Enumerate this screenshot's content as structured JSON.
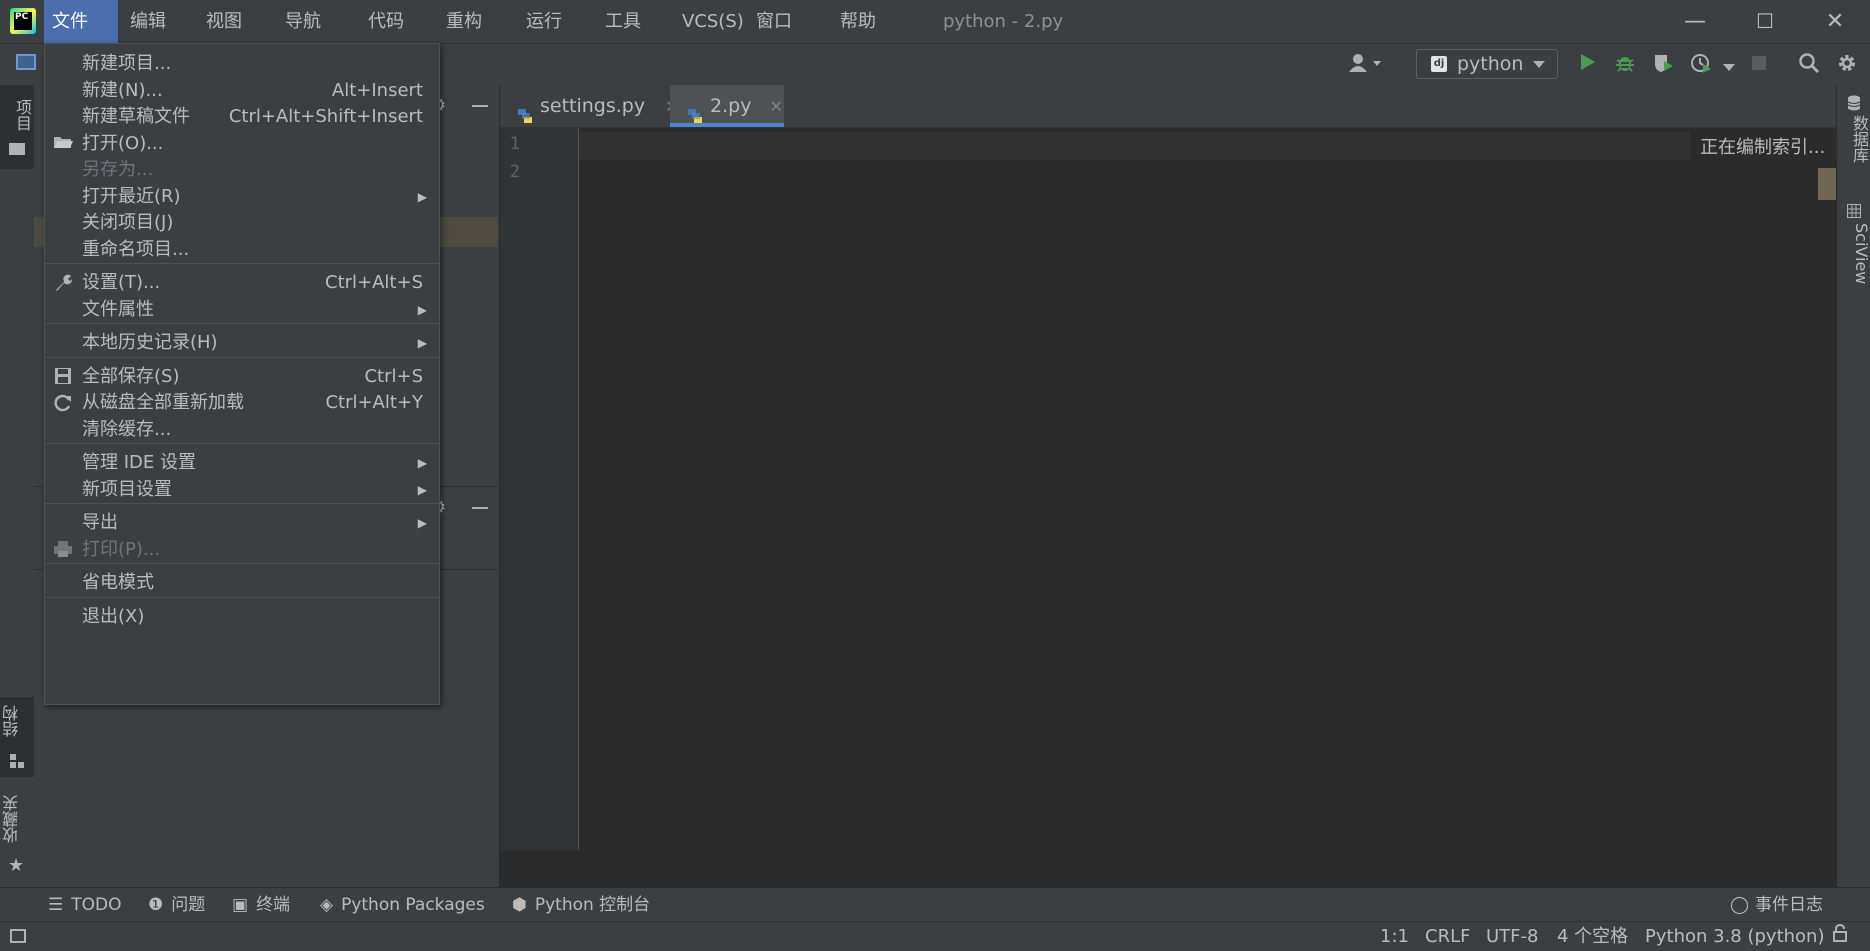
{
  "window": {
    "title": "python - 2.py",
    "minimize": "—",
    "maximize": "☐",
    "close": "✕"
  },
  "menubar": [
    "文件(F)",
    "编辑(E)",
    "视图(V)",
    "导航(N)",
    "代码(C)",
    "重构(R)",
    "运行(U)",
    "工具(T)",
    "VCS(S)",
    "窗口(W)",
    "帮助(H)"
  ],
  "toolbar": {
    "run_config": "python",
    "run_config_badge": "dj"
  },
  "left_tabs": {
    "project": "项目",
    "structure": "结构",
    "favorites": "收藏夹"
  },
  "right_tabs": {
    "database": "数据库",
    "sciview": "SciView"
  },
  "editor": {
    "tabs": [
      {
        "label": "settings.py",
        "active": false
      },
      {
        "label": "2.py",
        "active": true
      }
    ],
    "line_numbers": [
      "1",
      "2"
    ],
    "indexing_text": "正在编制索引..."
  },
  "file_menu": {
    "items": [
      {
        "label": "新建项目...",
        "shortcut": "",
        "icon": "",
        "submenu": false,
        "disabled": false
      },
      {
        "label": "新建(N)...",
        "shortcut": "Alt+Insert",
        "icon": "",
        "submenu": false,
        "disabled": false
      },
      {
        "label": "新建草稿文件",
        "shortcut": "Ctrl+Alt+Shift+Insert",
        "icon": "",
        "submenu": false,
        "disabled": false
      },
      {
        "label": "打开(O)...",
        "shortcut": "",
        "icon": "folder-icon",
        "submenu": false,
        "disabled": false
      },
      {
        "label": "另存为...",
        "shortcut": "",
        "icon": "",
        "submenu": false,
        "disabled": true
      },
      {
        "label": "打开最近(R)",
        "shortcut": "",
        "icon": "",
        "submenu": true,
        "disabled": false
      },
      {
        "label": "关闭项目(J)",
        "shortcut": "",
        "icon": "",
        "submenu": false,
        "disabled": false
      },
      {
        "label": "重命名项目...",
        "shortcut": "",
        "icon": "",
        "submenu": false,
        "disabled": false
      },
      {
        "sep": true
      },
      {
        "label": "设置(T)...",
        "shortcut": "Ctrl+Alt+S",
        "icon": "wrench-icon",
        "submenu": false,
        "disabled": false
      },
      {
        "label": "文件属性",
        "shortcut": "",
        "icon": "",
        "submenu": true,
        "disabled": false
      },
      {
        "sep": true
      },
      {
        "label": "本地历史记录(H)",
        "shortcut": "",
        "icon": "",
        "submenu": true,
        "disabled": false
      },
      {
        "sep": true
      },
      {
        "label": "全部保存(S)",
        "shortcut": "Ctrl+S",
        "icon": "save-icon",
        "submenu": false,
        "disabled": false
      },
      {
        "label": "从磁盘全部重新加载",
        "shortcut": "Ctrl+Alt+Y",
        "icon": "reload-icon",
        "submenu": false,
        "disabled": false
      },
      {
        "label": "清除缓存...",
        "shortcut": "",
        "icon": "",
        "submenu": false,
        "disabled": false
      },
      {
        "sep": true
      },
      {
        "label": "管理 IDE 设置",
        "shortcut": "",
        "icon": "",
        "submenu": true,
        "disabled": false
      },
      {
        "label": "新项目设置",
        "shortcut": "",
        "icon": "",
        "submenu": true,
        "disabled": false
      },
      {
        "sep": true
      },
      {
        "label": "导出",
        "shortcut": "",
        "icon": "",
        "submenu": true,
        "disabled": false
      },
      {
        "label": "打印(P)...",
        "shortcut": "",
        "icon": "print-icon",
        "submenu": false,
        "disabled": true
      },
      {
        "sep": true
      },
      {
        "label": "省电模式",
        "shortcut": "",
        "icon": "",
        "submenu": false,
        "disabled": false
      },
      {
        "sep": true
      },
      {
        "label": "退出(X)",
        "shortcut": "",
        "icon": "",
        "submenu": false,
        "disabled": false
      }
    ]
  },
  "bottom_tabs": [
    "TODO",
    "问题",
    "终端",
    "Python Packages",
    "Python 控制台"
  ],
  "event_log": "事件日志",
  "statusbar": {
    "position": "1:1",
    "line_sep": "CRLF",
    "encoding": "UTF-8",
    "indent": "4 个空格",
    "interpreter": "Python 3.8 (python)"
  },
  "colors": {
    "menu_active": "#4b6eaf",
    "run_green": "#499c54",
    "panel_bg": "#3c3f41",
    "editor_bg": "#2b2b2b"
  }
}
